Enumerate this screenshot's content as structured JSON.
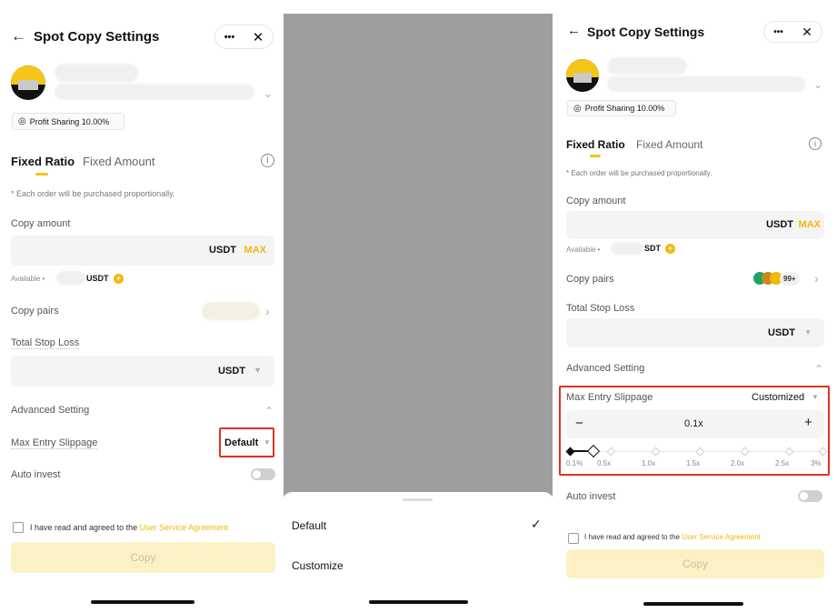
{
  "screen_left": {
    "title": "Spot Copy Settings",
    "more_glyph": "•••",
    "close_glyph": "✕",
    "back_glyph": "←",
    "profit_sharing": "Profit Sharing 10.00%",
    "tabs": [
      "Fixed Ratio",
      "Fixed Amount"
    ],
    "note": "* Each order will be purchased proportionally.",
    "copy_amount_label": "Copy amount",
    "currency": "USDT",
    "max_label": "MAX",
    "available_label": "Available •",
    "available_currency": "USDT",
    "copy_pairs_label": "Copy pairs",
    "total_stop_loss_label": "Total Stop Loss",
    "stop_loss_currency": "USDT",
    "advanced_setting_label": "Advanced Setting",
    "max_entry_slippage_label": "Max Entry Slippage",
    "slippage_value": "Default",
    "auto_invest_label": "Auto invest",
    "agree_text": "I have read and agreed to the",
    "agree_link": "User Service Agreement",
    "copy_button": "Copy"
  },
  "screen_middle": {
    "options": [
      {
        "label": "Default",
        "selected": true
      },
      {
        "label": "Customize",
        "selected": false
      }
    ],
    "check_glyph": "✓"
  },
  "screen_right": {
    "title": "Spot Copy Settings",
    "more_glyph": "•••",
    "close_glyph": "✕",
    "back_glyph": "←",
    "profit_sharing": "Profit Sharing 10.00%",
    "tabs": [
      "Fixed Ratio",
      "Fixed Amount"
    ],
    "note": "* Each order will be purchased proportionally.",
    "copy_amount_label": "Copy amount",
    "currency": "USDT",
    "max_label": "MAX",
    "available_label": "Available •",
    "available_currency": "SDT",
    "copy_pairs_label": "Copy pairs",
    "copy_pairs_count": "99+",
    "total_stop_loss_label": "Total Stop Loss",
    "stop_loss_currency": "USDT",
    "advanced_setting_label": "Advanced Setting",
    "max_entry_slippage_label": "Max Entry Slippage",
    "slippage_mode": "Customized",
    "slippage_value": "0.1x",
    "minus_glyph": "−",
    "plus_glyph": "+",
    "slider_ticks": [
      "0.1%",
      "0.5x",
      "1.0x",
      "1.5x",
      "2.0x",
      "2.5x",
      "3%"
    ],
    "slider_position": 0.03,
    "auto_invest_label": "Auto invest",
    "agree_text": "I have read and agreed to the",
    "agree_link": "User Service Agreement",
    "copy_button": "Copy"
  },
  "colors": {
    "accent": "#f0b90b",
    "highlight_border": "#e0331f",
    "overlay_gray": "#9e9e9e",
    "disabled_button": "#fbf1c5"
  },
  "icons": [
    "back-arrow-icon",
    "more-icon",
    "close-icon",
    "chevron-down-icon",
    "info-icon",
    "coin-icon",
    "chevron-right-icon",
    "chevron-up-icon",
    "dropdown-caret-icon",
    "checkmark-icon",
    "profit-icon"
  ]
}
